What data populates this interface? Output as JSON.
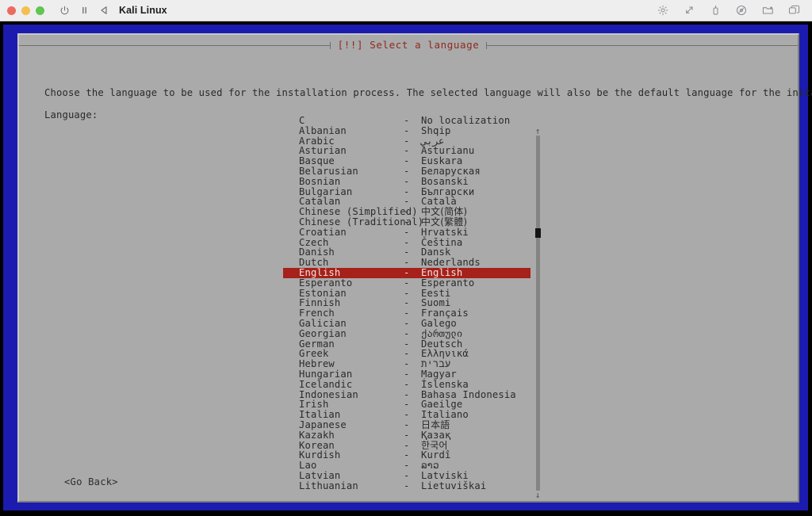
{
  "window": {
    "title": "Kali Linux",
    "traffic_lights": [
      "close",
      "minimize",
      "maximize"
    ],
    "left_icons": [
      "power-icon",
      "pause-icon",
      "back-icon"
    ],
    "right_icons": [
      "brightness-icon",
      "resize-icon",
      "usb-icon",
      "disc-icon",
      "shared-folder-icon",
      "windows-icon"
    ],
    "colors": {
      "close": "#ed6a5f",
      "minimize": "#f4bf4f",
      "maximize": "#61c554",
      "frame_blue": "#1b1bb0",
      "dialog_gray": "#aaaaaa",
      "banner_red": "#8d2a20",
      "selection_red": "#a6211a"
    }
  },
  "installer": {
    "banner": "[!!] Select a language",
    "intro": "Choose the language to be used for the installation process. The selected language will also be the default language for the installed system.",
    "field_label": "Language:",
    "go_back": "<Go Back>",
    "separator": "-",
    "scroll": {
      "up_arrow": "↑",
      "down_arrow": "↓"
    },
    "selected_language": "English",
    "languages": [
      {
        "english": "C",
        "native": "No localization"
      },
      {
        "english": "Albanian",
        "native": "Shqip"
      },
      {
        "english": "Arabic",
        "native": "عربي"
      },
      {
        "english": "Asturian",
        "native": "Asturianu"
      },
      {
        "english": "Basque",
        "native": "Euskara"
      },
      {
        "english": "Belarusian",
        "native": "Беларуская"
      },
      {
        "english": "Bosnian",
        "native": "Bosanski"
      },
      {
        "english": "Bulgarian",
        "native": "Български"
      },
      {
        "english": "Catalan",
        "native": "Català"
      },
      {
        "english": "Chinese (Simplified)",
        "native": "中文(简体)",
        "cjk": true
      },
      {
        "english": "Chinese (Traditional)",
        "native": "中文(繁體)",
        "cjk": true
      },
      {
        "english": "Croatian",
        "native": "Hrvatski"
      },
      {
        "english": "Czech",
        "native": "Čeština"
      },
      {
        "english": "Danish",
        "native": "Dansk"
      },
      {
        "english": "Dutch",
        "native": "Nederlands"
      },
      {
        "english": "English",
        "native": "English",
        "selected": true
      },
      {
        "english": "Esperanto",
        "native": "Esperanto"
      },
      {
        "english": "Estonian",
        "native": "Eesti"
      },
      {
        "english": "Finnish",
        "native": "Suomi"
      },
      {
        "english": "French",
        "native": "Français"
      },
      {
        "english": "Galician",
        "native": "Galego"
      },
      {
        "english": "Georgian",
        "native": "ქართული"
      },
      {
        "english": "German",
        "native": "Deutsch"
      },
      {
        "english": "Greek",
        "native": "Ελληνικά"
      },
      {
        "english": "Hebrew",
        "native": "עברית"
      },
      {
        "english": "Hungarian",
        "native": "Magyar"
      },
      {
        "english": "Icelandic",
        "native": "Íslenska"
      },
      {
        "english": "Indonesian",
        "native": "Bahasa Indonesia"
      },
      {
        "english": "Irish",
        "native": "Gaeilge"
      },
      {
        "english": "Italian",
        "native": "Italiano"
      },
      {
        "english": "Japanese",
        "native": "日本語",
        "cjk": true
      },
      {
        "english": "Kazakh",
        "native": "Қазақ"
      },
      {
        "english": "Korean",
        "native": "한국어",
        "cjk": true
      },
      {
        "english": "Kurdish",
        "native": "Kurdî"
      },
      {
        "english": "Lao",
        "native": "ລາວ"
      },
      {
        "english": "Latvian",
        "native": "Latviski"
      },
      {
        "english": "Lithuanian",
        "native": "Lietuviškai"
      }
    ]
  }
}
